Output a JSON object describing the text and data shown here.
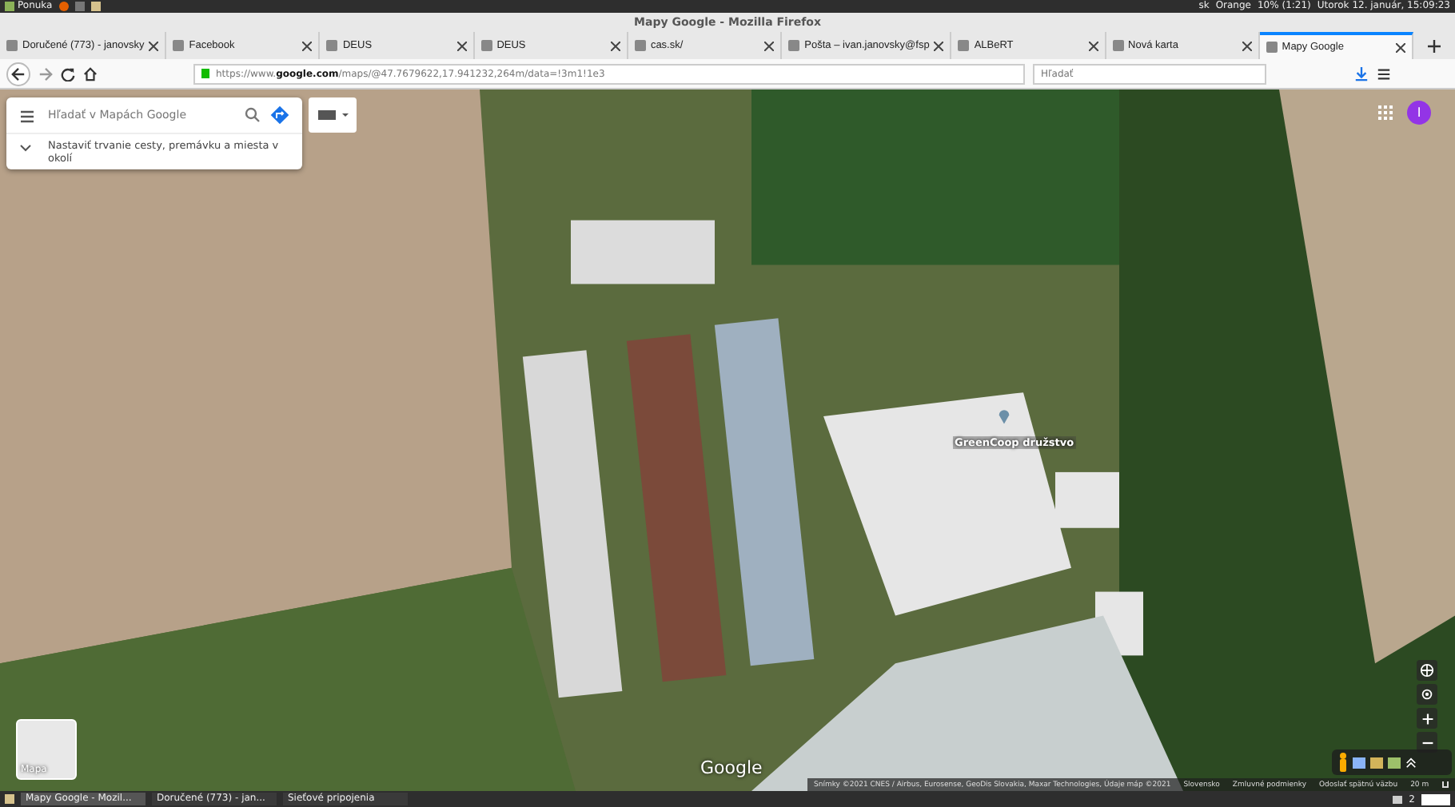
{
  "system_panel": {
    "menu": "Ponuka",
    "keyboard": "sk",
    "network": "Orange",
    "battery": "10% (1:21)",
    "clock": "Utorok 12. január, 15:09:23"
  },
  "window": {
    "title": "Mapy Google - Mozilla Firefox"
  },
  "tabs": [
    {
      "label": "Doručené (773) - janovsky",
      "selected": false
    },
    {
      "label": "Facebook",
      "selected": false
    },
    {
      "label": "DEUS",
      "selected": false
    },
    {
      "label": "DEUS",
      "selected": false
    },
    {
      "label": "cas.sk/",
      "selected": false
    },
    {
      "label": "Pošta – ivan.janovsky@fsp",
      "selected": false
    },
    {
      "label": "ALBeRT",
      "selected": false
    },
    {
      "label": "Nová karta",
      "selected": false
    },
    {
      "label": "Mapy Google",
      "selected": true
    }
  ],
  "address_bar": {
    "url": "https://www.**google.com**/maps/@47.7679622,17.941232,264m/data=!3m1!1e3"
  },
  "search_bar": {
    "placeholder": "Hľadať"
  },
  "map": {
    "search": {
      "placeholder": "Hľadať v Mapách Google"
    },
    "suggestion": "Nastaviť trvanie cesty, premávku a miesta v okolí",
    "avatar": "I",
    "place_label": "GreenCoop družstvo",
    "layer_label": "Mapa",
    "logo": "Google",
    "attribution": "Snímky ©2021 CNES / Airbus, Eurosense, GeoDis Slovakia, Maxar Technologies, Údaje máp ©2021",
    "footer_links": [
      "Slovensko",
      "Zmluvné podmienky",
      "Odoslať spätnú väzbu"
    ],
    "scale": "20 m"
  },
  "taskbar": {
    "items": [
      {
        "label": "Mapy Google - Mozil...",
        "selected": true
      },
      {
        "label": "Doručené (773) - jan...",
        "selected": false
      },
      {
        "label": "Sieťové pripojenia",
        "selected": false
      }
    ],
    "notifications": "2"
  }
}
